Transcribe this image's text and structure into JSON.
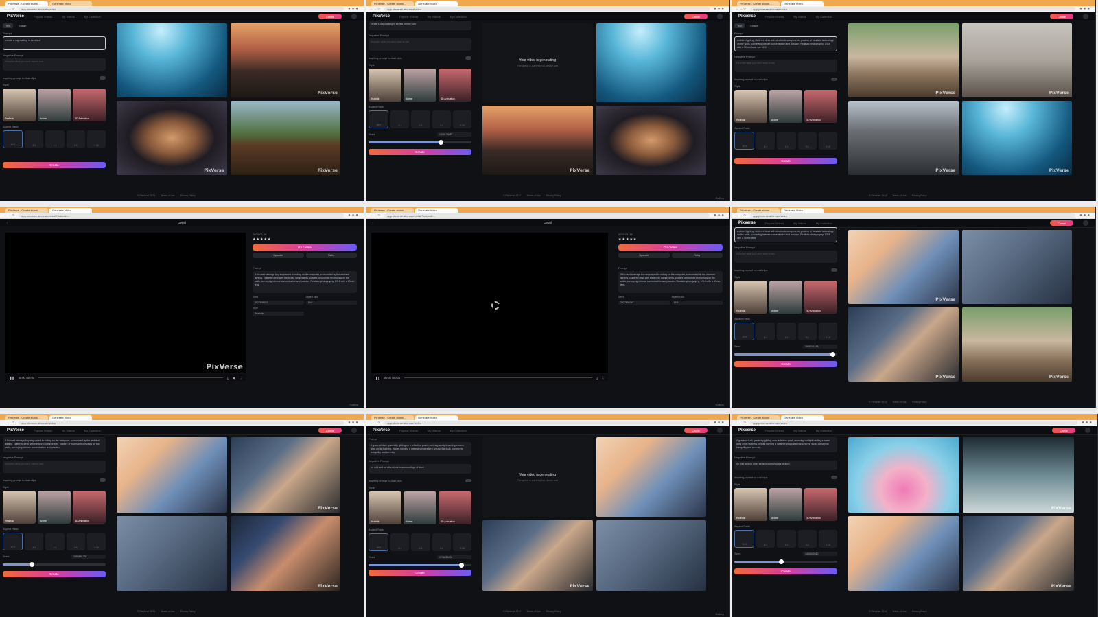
{
  "browser": {
    "tab_1": "PixVerse - Create stunni…",
    "tab_2": "Generate Video",
    "url": "app.pixverse.ai/create/video",
    "url_detail": "app.pixverse.ai/create/detail?videoId=…"
  },
  "app": {
    "logo": "PixVerse",
    "menu_1": "Popular Videos",
    "menu_2": "My Videos",
    "menu_3": "My Collection",
    "create_label": "Create",
    "mode_text": "Text",
    "mode_image": "Image"
  },
  "form": {
    "prompt_label": "Prompt",
    "negative_label": "Negative Prompt",
    "negative_placeholder": "Describe what you don't want to see",
    "inspiring_label": "Inspiring prompt to dual-clips",
    "style_label": "Style",
    "aspect_label": "Aspect Ratio",
    "seed_label": "Seed",
    "create_button": "Create",
    "styles": [
      "Realistic",
      "Anime",
      "3D Animation"
    ],
    "ratios": [
      "16:9",
      "4:3",
      "1:1",
      "3:4",
      "9:16"
    ]
  },
  "panels": {
    "p1_prompt": "create a dog walking in streets of",
    "p2_prompt": "create a dog walking in streets of new york",
    "p3_prompt": "ambient lighting, cluttered desk with electronic components, posters of futuristic technology on the walls, conveying intense concentration and passion. Realistic photography, 1/3.8 with a 50mm lens. --ar 16:9",
    "p6_prompt": "ambient lighting, cluttered desk with electronic components, posters of futuristic technology on the walls, conveying intense concentration and passion. Realistic photography, 1/3.8 with a 50mm lens.",
    "p7_prompt": "A focused teenage boy engrossed in coding on the computer, surrounded by the ambient lighting, cluttered desk with electronic components, posters of futuristic technology on the walls, conveying intense concentration and passion.",
    "p8_prompt": "A graceful duck gracefully gliding on a reflective pond, receiving sunlight casting a warm glow on its feathers, ripples forming a mesmerizing pattern around the duck, conveying tranquility and serenity.",
    "p8_negative": "no mist and no other birds in surroundings of duck",
    "p9_prompt": "A graceful duck gracefully gliding on a reflective pond, receiving sunlight casting a warm glow on its feathers, ripples forming a mesmerizing pattern around the duck, conveying tranquility and serenity.",
    "p9_negative": "no mist and no other birds in surroundings of duck",
    "seed_1": "1026136087",
    "seed_2": "1549241418",
    "seed_3": "1096651228",
    "seed_4": "1746284894",
    "seed_5": "1434040310"
  },
  "generating": {
    "title": "Your video is generating",
    "subtitle": "The queue is currently full, please wait"
  },
  "detail": {
    "title": "Detail",
    "back": "‹",
    "date": "2024-01-16",
    "stars": "★★★★★",
    "go_create": "Go create",
    "upscale": "Upscale",
    "retry": "Retry",
    "prompt_label": "Prompt",
    "prompt_text": "A focused teenage boy engrossed in coding on the computer, surrounded by the ambient lighting, cluttered desk with electronic components, posters of futuristic technology on the walls, conveying intense concentration and passion. Realistic photography, 1/3.8 with a 50mm lens.",
    "seed_label": "Seed",
    "seed_value": "2027806347",
    "ratio_label": "Aspect ratio",
    "ratio_value": "16:9",
    "style_label": "Style",
    "style_value": "Realistic",
    "time": "00:00 / 00:04",
    "watermark": "PixVerse"
  },
  "footer": {
    "copyright": "© PixVerse 2024",
    "terms": "Terms of Use",
    "privacy": "Privacy Policy"
  },
  "watermark": "PixVerse",
  "corner_label": "Gallery"
}
